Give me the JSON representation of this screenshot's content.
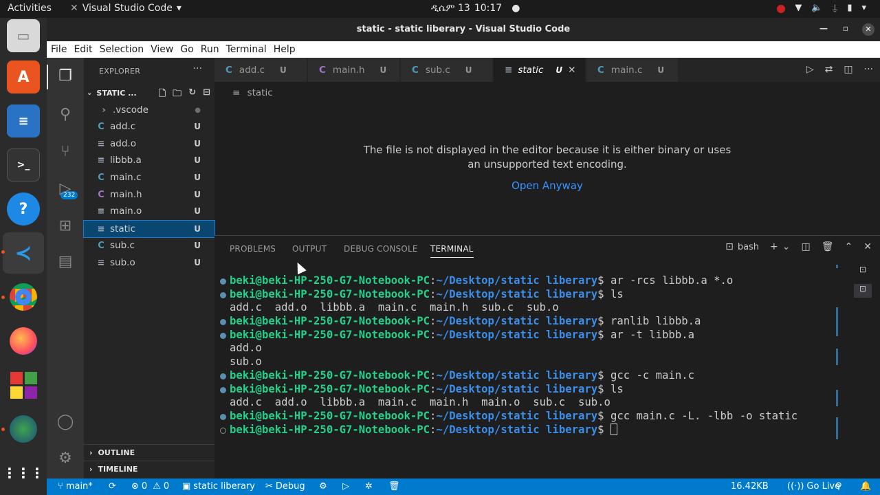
{
  "gnome": {
    "activities": "Activities",
    "app_name": "Visual Studio Code",
    "date": "ዲሴም 13",
    "time": "10:17"
  },
  "window": {
    "title": "static - static liberary - Visual Studio Code"
  },
  "menu": [
    "File",
    "Edit",
    "Selection",
    "View",
    "Go",
    "Run",
    "Terminal",
    "Help"
  ],
  "activity": {
    "scm_badge": "232"
  },
  "sidebar": {
    "header": "EXPLORER",
    "folder": "STATIC ...",
    "files": [
      {
        "name": ".vscode",
        "status": "●"
      },
      {
        "name": "add.c",
        "status": "U"
      },
      {
        "name": "add.o",
        "status": "U"
      },
      {
        "name": "libbb.a",
        "status": "U"
      },
      {
        "name": "main.c",
        "status": "U"
      },
      {
        "name": "main.h",
        "status": "U"
      },
      {
        "name": "main.o",
        "status": "U"
      },
      {
        "name": "static",
        "status": "U"
      },
      {
        "name": "sub.c",
        "status": "U"
      },
      {
        "name": "sub.o",
        "status": "U"
      }
    ],
    "outline": "OUTLINE",
    "timeline": "TIMELINE"
  },
  "tabs": [
    {
      "label": "add.c",
      "status": "U"
    },
    {
      "label": "main.h",
      "status": "U"
    },
    {
      "label": "sub.c",
      "status": "U"
    },
    {
      "label": "static",
      "status": "U"
    },
    {
      "label": "main.c",
      "status": "U"
    }
  ],
  "editor": {
    "breadcrumb": "static",
    "message_line1": "The file is not displayed in the editor because it is either binary or uses",
    "message_line2": "an unsupported text encoding.",
    "open_anyway": "Open Anyway"
  },
  "panel": {
    "tabs": [
      "PROBLEMS",
      "OUTPUT",
      "DEBUG CONSOLE",
      "TERMINAL"
    ],
    "shell": "bash",
    "prompt_user": "beki@beki-HP-250-G7-Notebook-PC",
    "prompt_path": "~/Desktop/static liberary",
    "lines": [
      {
        "type": "cmd",
        "text": "ar -rcs libbb.a *.o"
      },
      {
        "type": "cmd",
        "text": "ls"
      },
      {
        "type": "out",
        "text": "add.c  add.o  libbb.a  main.c  main.h  sub.c  sub.o"
      },
      {
        "type": "cmd",
        "text": "ranlib libbb.a"
      },
      {
        "type": "cmd",
        "text": "ar -t libbb.a"
      },
      {
        "type": "out",
        "text": "add.o"
      },
      {
        "type": "out",
        "text": "sub.o"
      },
      {
        "type": "cmd",
        "text": "gcc -c main.c"
      },
      {
        "type": "cmd",
        "text": "ls"
      },
      {
        "type": "out",
        "text": "add.c  add.o  libbb.a  main.c  main.h  main.o  sub.c  sub.o"
      },
      {
        "type": "cmd",
        "text": "gcc main.c -L. -lbb -o static"
      },
      {
        "type": "prompt",
        "text": ""
      }
    ]
  },
  "status": {
    "branch": "main*",
    "errors": "0",
    "warnings": "0",
    "folder": "static liberary",
    "debug": "Debug",
    "size": "16.42KB",
    "golive": "Go Live"
  },
  "colors": {
    "accent": "#007acc",
    "terminal_user": "#23d18b",
    "terminal_path": "#3b8eea"
  }
}
